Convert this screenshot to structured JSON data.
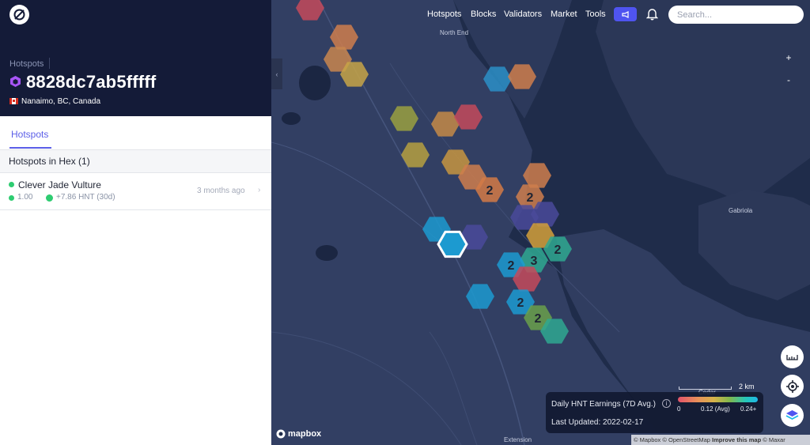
{
  "sidebar": {
    "breadcrumb": "Hotspots",
    "title": "8828dc7ab5fffff",
    "location": "Nanaimo, BC, Canada",
    "tab": "Hotspots",
    "section_title": "Hotspots in Hex (1)",
    "hotspot": {
      "name": "Clever Jade Vulture",
      "scale": "1.00",
      "earnings": "+7.86 HNT (30d)",
      "time": "3 months ago"
    }
  },
  "nav": {
    "items": [
      "Hotspots",
      "Blocks",
      "Validators",
      "Market",
      "Tools"
    ],
    "search_placeholder": "Search..."
  },
  "map": {
    "place_labels": [
      "North End",
      "Gabriola",
      "Extension",
      "Cedar"
    ],
    "zoom_in": "+",
    "zoom_out": "-",
    "hex_counts": [
      "2",
      "2",
      "2",
      "3",
      "2",
      "2",
      "2"
    ],
    "legend": {
      "title": "Daily HNT Earnings (7D Avg.)",
      "tick_min": "0",
      "tick_avg": "0.12 (Avg)",
      "tick_max": "0.24+",
      "updated": "Last Updated: 2022-02-17"
    },
    "scale_label": "2 km",
    "logo": "mapbox",
    "attribution": [
      "© Mapbox",
      "© OpenStreetMap",
      "Improve this map",
      "© Maxar"
    ]
  },
  "colors": {
    "panel_header": "#141b38",
    "accent": "#5b5ee8",
    "online": "#2ecc71"
  }
}
